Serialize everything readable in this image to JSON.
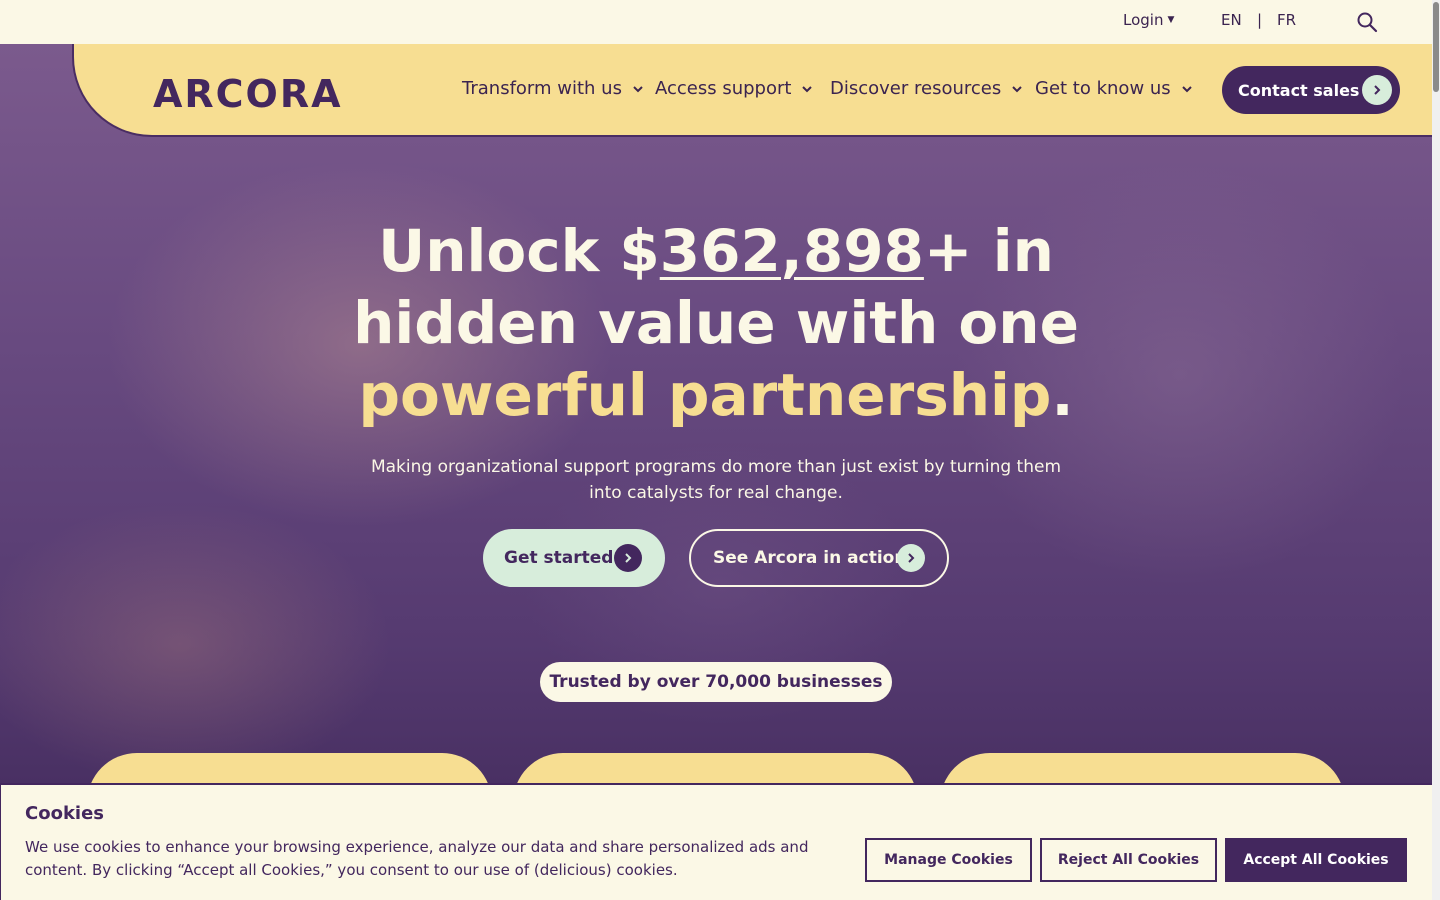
{
  "topbar": {
    "login_label": "Login",
    "lang_en": "EN",
    "lang_separator": "|",
    "lang_fr": "FR",
    "search_icon": "search-icon"
  },
  "nav": {
    "logo": "ARCORA",
    "items": [
      {
        "label": "Transform with us"
      },
      {
        "label": "Access support"
      },
      {
        "label": "Discover resources"
      },
      {
        "label": "Get to know us"
      }
    ],
    "contact_label": "Contact sales"
  },
  "hero": {
    "headline_part1": "Unlock $",
    "headline_amount": "362,898",
    "headline_part2": "+ in hidden value with one",
    "headline_accent": "powerful partnership",
    "headline_end": ".",
    "subtext": "Making organizational support programs do more than just exist by turning them into catalysts for real change.",
    "cta_primary": "Get started",
    "cta_secondary": "See Arcora in action",
    "trusted": "Trusted by over 70,000 businesses"
  },
  "cookie": {
    "title": "Cookies",
    "text": "We use cookies to enhance your browsing experience, analyze our data and share personalized ads and content. By clicking “Accept all Cookies,” you consent to our use of (delicious) cookies.",
    "manage": "Manage Cookies",
    "reject": "Reject All Cookies",
    "accept": "Accept All Cookies"
  },
  "colors": {
    "brand_purple": "#43275e",
    "brand_yellow": "#f7de92",
    "brand_mint": "#d7eddb",
    "cream": "#fbf8e6"
  }
}
